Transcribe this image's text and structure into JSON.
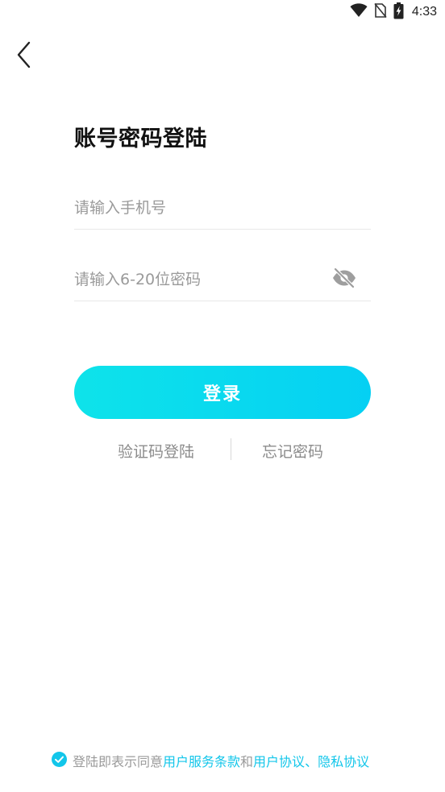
{
  "status_bar": {
    "time": "4:33",
    "icons": [
      "wifi-icon",
      "no-sim-icon",
      "battery-charging-icon"
    ]
  },
  "nav": {
    "back_icon": "chevron-left-icon"
  },
  "page": {
    "title": "账号密码登陆"
  },
  "form": {
    "phone": {
      "placeholder": "请输入手机号",
      "value": ""
    },
    "password": {
      "placeholder": "请输入6-20位密码",
      "value": "",
      "visibility_icon": "eye-off-icon"
    },
    "login_button": "登录"
  },
  "alt_links": {
    "sms_login": "验证码登陆",
    "forgot_password": "忘记密码"
  },
  "agreement": {
    "checked": true,
    "check_icon": "check-circle-icon",
    "prefix": "登陆即表示同意",
    "terms_link": "用户服务条款",
    "and": "和",
    "user_agreement_link": "用户协议",
    "separator": "、",
    "privacy_link": "隐私协议"
  },
  "colors": {
    "accent": "#12c6ea",
    "button_gradient_start": "#0ee3ea",
    "button_gradient_end": "#05d0f3",
    "placeholder": "#9a9a9a",
    "divider": "#e8e8e8"
  }
}
